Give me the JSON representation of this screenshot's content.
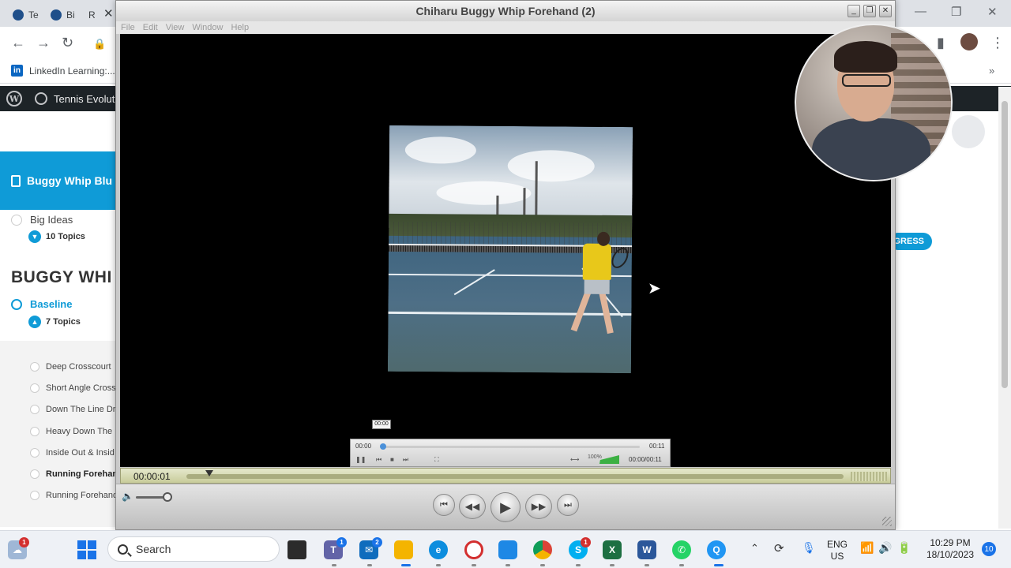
{
  "browser": {
    "tabs": [
      {
        "label": "Te"
      },
      {
        "label": "Bi"
      },
      {
        "label": "R"
      }
    ],
    "bookmark": {
      "label": "LinkedIn Learning:..."
    }
  },
  "wp_admin": {
    "site_name": "Tennis Evoluti"
  },
  "course": {
    "header": "Buggy Whip Blu",
    "big_ideas": "Big Ideas",
    "big_ideas_topics": "10 Topics",
    "section_title": "BUGGY WHI",
    "baseline": "Baseline",
    "baseline_topics": "7 Topics",
    "topics": [
      {
        "label": "Deep Crosscourt",
        "bold": false
      },
      {
        "label": "Short Angle Cross",
        "bold": false
      },
      {
        "label": "Down The Line Dr",
        "bold": false
      },
      {
        "label": "Heavy Down The",
        "bold": false
      },
      {
        "label": "Inside Out & Insid",
        "bold": false
      },
      {
        "label": "Running Forehan",
        "bold": true
      },
      {
        "label": "Running Forehand",
        "bold": false
      }
    ],
    "progress_label": "GRESS"
  },
  "player": {
    "title": "Chiharu Buggy Whip Forehand (2)",
    "menu": [
      "File",
      "Edit",
      "View",
      "Window",
      "Help"
    ],
    "tooltip_time": "00:00",
    "inner": {
      "time_start": "00:00",
      "time_end": "00:11",
      "volume_pct": "100%",
      "time_total": "00:00/00:11"
    },
    "current_time": "00:00:01"
  },
  "taskbar": {
    "search_label": "Search",
    "language": "ENG",
    "region": "US",
    "time": "10:29 PM",
    "date": "18/10/2023",
    "notifications": "10",
    "badges": {
      "weather": "1",
      "teams": "1",
      "mail": "2",
      "skype": "1"
    }
  },
  "colors": {
    "accent": "#0f9bd7",
    "wp_bar": "#1d2327",
    "player_seek": "#c8cc9a"
  }
}
